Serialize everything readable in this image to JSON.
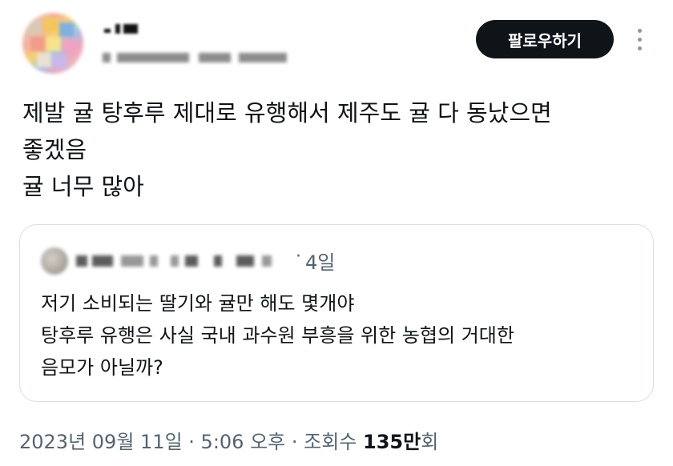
{
  "header": {
    "follow_label": "팔로우하기"
  },
  "tweet": {
    "lines": [
      "제발 귤 탕후루 제대로 유행해서 제주도 귤 다 동났으면",
      "좋겠음",
      "귤 너무 많아"
    ]
  },
  "quote": {
    "time": "4일",
    "lines": [
      "저기 소비되는 딸기와 귤만 해도 몇개야",
      "탕후루 유행은 사실 국내 과수원 부흥을 위한 농협의 거대한",
      "음모가 아닐까?"
    ]
  },
  "meta": {
    "date": "2023년 09월 11일",
    "sep1": " · ",
    "time": "5:06 오후",
    "sep2": " · ",
    "views_label": "조회수 ",
    "views_count": "135만",
    "views_unit": "회"
  },
  "icons": {
    "more": "more-vertical-icon"
  }
}
